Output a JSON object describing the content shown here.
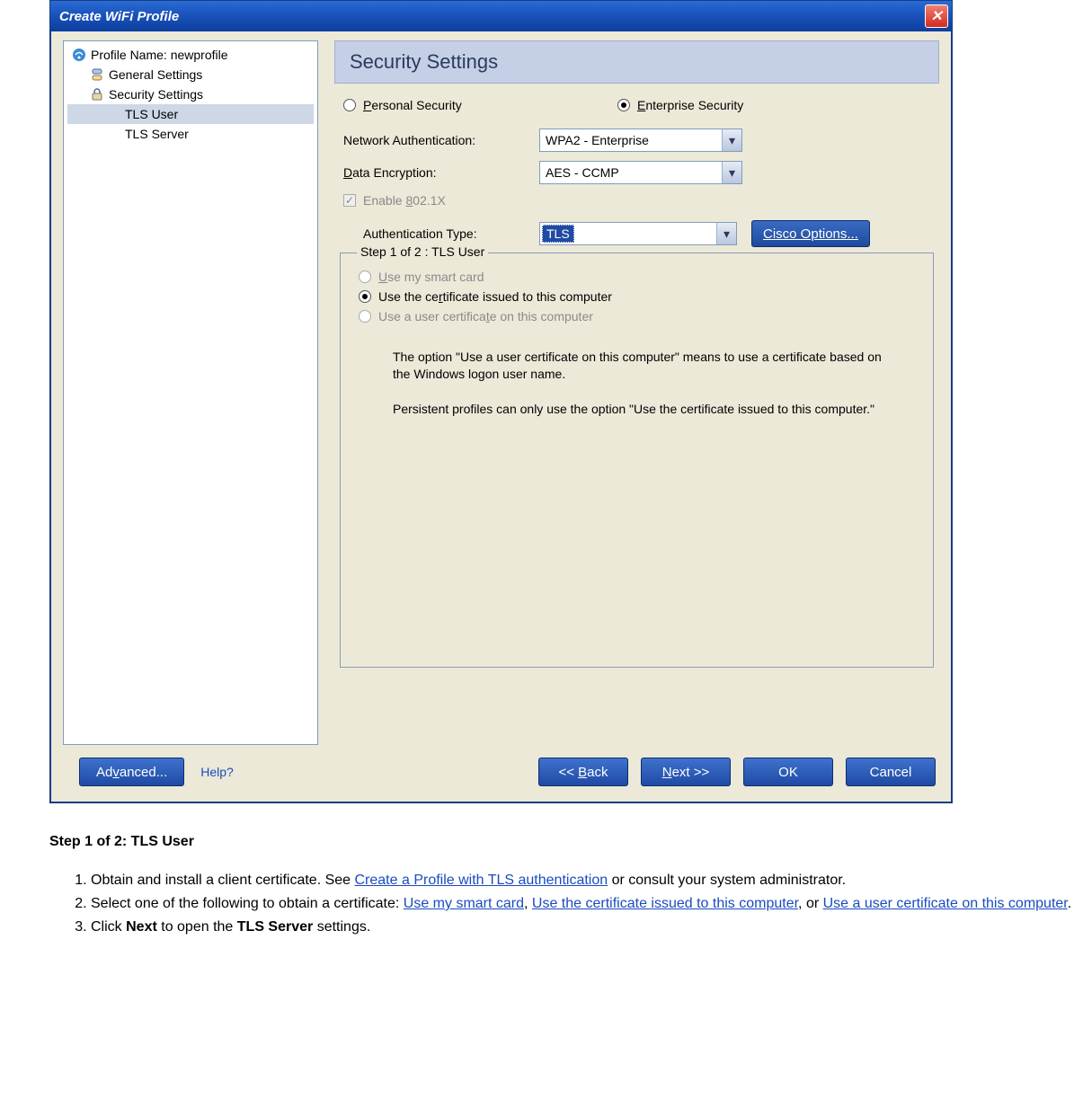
{
  "dialog": {
    "title": "Create WiFi Profile",
    "close": "✕"
  },
  "tree": {
    "profile_label": "Profile Name:",
    "profile_name": "newprofile",
    "general": "General Settings",
    "security": "Security Settings",
    "tls_user": "TLS User",
    "tls_server": "TLS Server"
  },
  "panel": {
    "title": "Security Settings",
    "personal": "ersonal Security",
    "personal_u": "P",
    "enterprise": "nterprise Security",
    "enterprise_u": "E",
    "netauth_label": "Network Authentication:",
    "netauth_value": "WPA2 - Enterprise",
    "dataenc_u": "D",
    "dataenc_label": "ata Encryption:",
    "dataenc_value": "AES - CCMP",
    "enable_8021x": "Enable 802.1X",
    "enable_8021x_u": "8",
    "authtype_label": "Authentication Type:",
    "authtype_value": "TLS",
    "cisco_btn": "isco Options...",
    "cisco_u": "C"
  },
  "group": {
    "legend": "Step 1 of 2 : TLS User",
    "r1_pre": "se my smart card",
    "r1_u": "U",
    "r2_pre_a": "Use the ce",
    "r2_u": "r",
    "r2_pre_b": "tificate issued to this computer",
    "r3_pre_a": "Use a user certifica",
    "r3_u": "t",
    "r3_pre_b": "e on this computer",
    "desc1": "The option \"Use a user certificate on this computer\" means to use a certificate based on the Windows logon user name.",
    "desc2": "Persistent profiles can only use the option \"Use the certificate issued to this computer.\""
  },
  "buttons": {
    "advanced": "anced...",
    "advanced_pre": "Ad",
    "advanced_u": "v",
    "help": "Help?",
    "back": "ack",
    "back_pre": "<< ",
    "back_u": "B",
    "next": "ext >>",
    "next_u": "N",
    "ok": "OK",
    "cancel": "Cancel"
  },
  "doc": {
    "heading": "Step 1 of 2: TLS User",
    "li1a": "Obtain and install a client certificate. See ",
    "li1link": "Create a Profile with TLS authentication",
    "li1b": " or consult your system administrator.",
    "li2a": "Select one of the following to obtain a certificate: ",
    "li2link1": "Use my smart card",
    "li2sep1": ", ",
    "li2link2": "Use the certificate issued to this computer",
    "li2sep2": ", or ",
    "li2link3": "Use a user certificate on this computer",
    "li2b": ".",
    "li3a": "Click ",
    "li3bold1": "Next",
    "li3b": " to open the ",
    "li3bold2": "TLS Server",
    "li3c": " settings."
  }
}
